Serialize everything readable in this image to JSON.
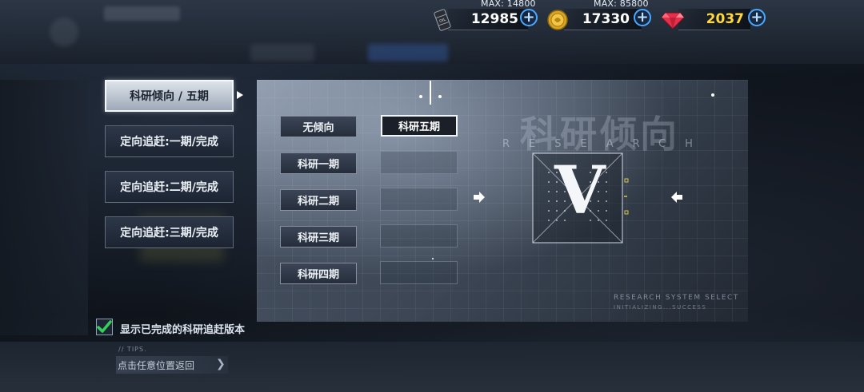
{
  "resources": {
    "oil": {
      "max_label": "MAX: 14800",
      "value": "12985",
      "icon": "oil-barrel-icon"
    },
    "gold": {
      "max_label": "MAX: 85800",
      "value": "17330",
      "icon": "gold-coin-icon"
    },
    "gem": {
      "value": "2037",
      "icon": "gem-icon",
      "color": "#ffd83a"
    }
  },
  "tabs": [
    {
      "label": "科研倾向 / 五期",
      "active": true
    },
    {
      "label": "定向追赶:一期/完成",
      "active": false
    },
    {
      "label": "定向追赶:二期/完成",
      "active": false
    },
    {
      "label": "定向追赶:三期/完成",
      "active": false
    }
  ],
  "options": {
    "left": [
      "无倾向",
      "科研一期",
      "科研二期",
      "科研三期",
      "科研四期"
    ],
    "selected": "科研五期"
  },
  "panel": {
    "title": "科研倾向",
    "subtitle": "RESEARCH",
    "roman": "V",
    "system_line1": "RESEARCH SYSTEM SELECT",
    "system_line2": "INITIALIZING...SUCCESS"
  },
  "show_completed": {
    "checked": true,
    "label": "显示已完成的科研追赶版本",
    "check_color": "#34d15a"
  },
  "tips": {
    "caption": "// TIPS.",
    "text": "点击任意位置返回"
  }
}
